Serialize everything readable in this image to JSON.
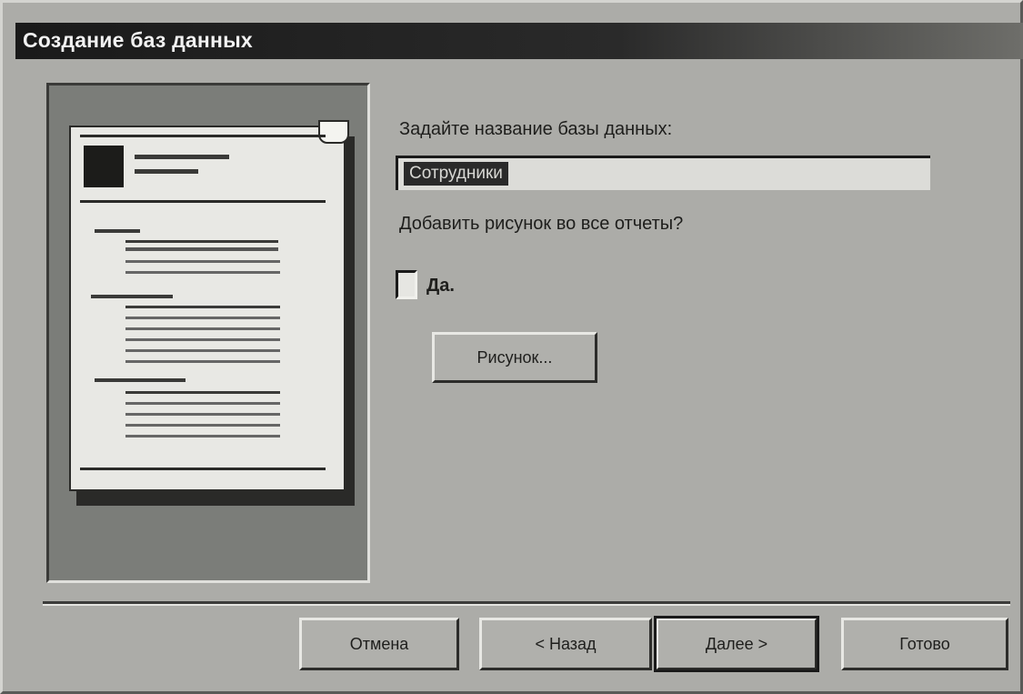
{
  "window": {
    "title": "Создание баз данных"
  },
  "form": {
    "name_prompt": "Задайте название базы данных:",
    "name_value": "Сотрудники",
    "picture_prompt": "Добавить рисунок во все отчеты?",
    "checkbox_label": "Да.",
    "checkbox_checked": false,
    "picture_button": "Рисунок..."
  },
  "buttons": {
    "cancel": "Отмена",
    "back": "< Назад",
    "next": "Далее >",
    "finish": "Готово"
  }
}
